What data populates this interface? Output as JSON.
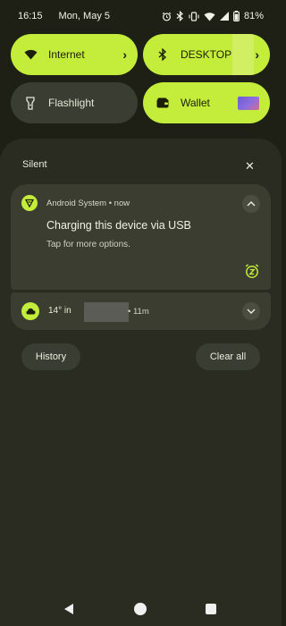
{
  "status_bar": {
    "time": "16:15",
    "date": "Mon, May 5",
    "battery": "81%",
    "icons": [
      "alarm-icon",
      "bluetooth-icon",
      "vibrate-icon",
      "wifi-icon",
      "signal-icon",
      "battery-icon"
    ]
  },
  "quick_settings": {
    "tiles": [
      {
        "label": "Internet",
        "icon": "wifi-icon",
        "state": "on"
      },
      {
        "label": "DESKTOP",
        "icon": "bluetooth-icon",
        "state": "on"
      },
      {
        "label": "Flashlight",
        "icon": "flashlight-icon",
        "state": "off"
      },
      {
        "label": "Wallet",
        "icon": "wallet-icon",
        "state": "on"
      }
    ]
  },
  "shade": {
    "section_label": "Silent",
    "notification": {
      "app": "Android System • now",
      "title": "Charging this device via USB",
      "subtitle": "Tap for more options."
    },
    "weather": {
      "temp": "14° in",
      "time": "• 11m"
    },
    "history_label": "History",
    "clear_label": "Clear all"
  },
  "colors": {
    "accent": "#c4ec3a",
    "background": "#1e2016",
    "card": "#3a3d30"
  }
}
